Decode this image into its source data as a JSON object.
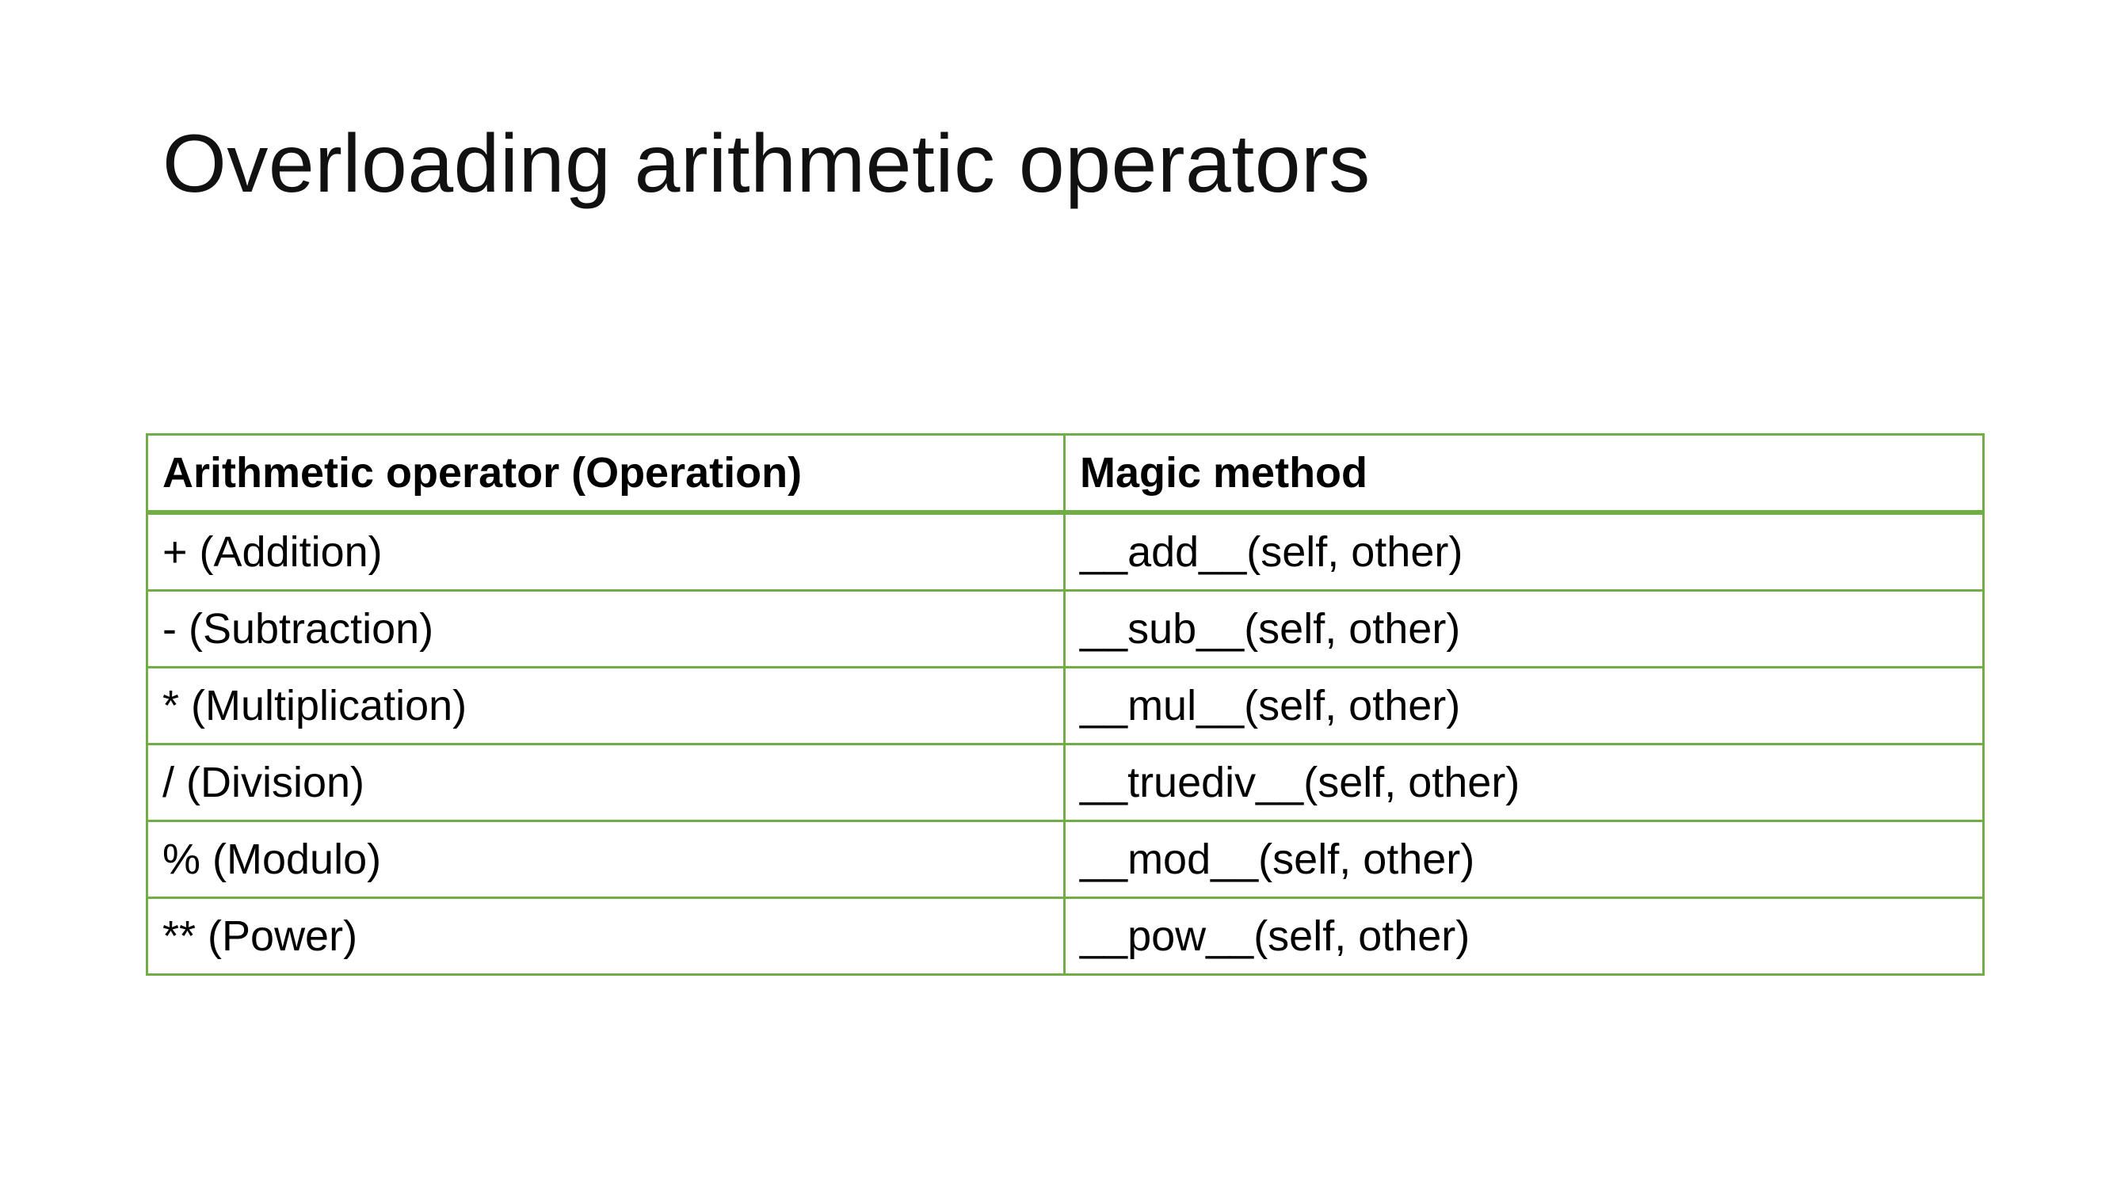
{
  "title": "Overloading arithmetic operators",
  "colors": {
    "table_border": "#70ad47",
    "background": "#ffffff",
    "text": "#000000"
  },
  "table": {
    "headers": [
      "Arithmetic operator (Operation)",
      "Magic method"
    ],
    "rows": [
      [
        "+ (Addition)",
        "__add__(self, other)"
      ],
      [
        "- (Subtraction)",
        "__sub__(self, other)"
      ],
      [
        "* (Multiplication)",
        "__mul__(self, other)"
      ],
      [
        "/ (Division)",
        "__truediv__(self, other)"
      ],
      [
        "% (Modulo)",
        "__mod__(self, other)"
      ],
      [
        "** (Power)",
        "__pow__(self, other)"
      ]
    ]
  }
}
